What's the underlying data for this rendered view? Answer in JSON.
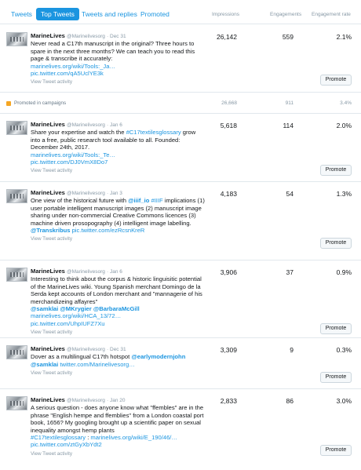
{
  "tabs": [
    "Tweets",
    "Top Tweets",
    "Tweets and replies",
    "Promoted"
  ],
  "columns": {
    "impressions": "Impressions",
    "engagements": "Engagements",
    "rate": "Engagement rate"
  },
  "view_activity": "View Tweet activity",
  "promote_label": "Promote",
  "promoted": {
    "label": "Promoted in campaigns",
    "impressions": "26,668",
    "engagements": "911",
    "rate": "3.4%"
  },
  "tweets": [
    {
      "name": "MarineLives",
      "handle": "@Marinelivesorg",
      "date": "· Dec 31",
      "text": "Never read a C17th manuscript in the original? Three hours to spare in the next three months? We can teach you to read this page & transcribe it accurately:",
      "link1": "marinelives.org/wiki/Tools:_Ja…",
      "link2": "pic.twitter.com/qA5UclYE3k",
      "impressions": "26,142",
      "engagements": "559",
      "rate": "2.1%"
    },
    {
      "name": "MarineLives",
      "handle": "@Marinelivesorg",
      "date": "· Jan 6",
      "text_a": "Share your expertise and watch the ",
      "hashtag": "#C17textilesglossary",
      "text_b": " grow into a free, public research tool available to all. Founded: December 24th, 2017.",
      "link1": "marinelives.org/wiki/Tools:_Te…",
      "link2": "pic.twitter.com/DJ0VmX8Do7",
      "impressions": "5,618",
      "engagements": "114",
      "rate": "2.0%"
    },
    {
      "name": "MarineLives",
      "handle": "@Marinelivesorg",
      "date": "· Jan 3",
      "text_a": "One view of the historical future with ",
      "mention1": "@iiif_io",
      "hashtag": "#IIIF",
      "text_b": " implications (1) user portable intelligent manuscript images (2) manuscript image sharing under non-commercial Creative Commons licences (3) machine driven prosopography (4) intelligent image labelling.",
      "mention2": "@Transkribus",
      "link2": "pic.twitter.com/ezRcsnKreR",
      "impressions": "4,183",
      "engagements": "54",
      "rate": "1.3%"
    },
    {
      "name": "MarineLives",
      "handle": "@Marinelivesorg",
      "date": "· Jan 6",
      "text": "Interesting to think about the corpus & historic linguisitic potential of the MarineLives wiki. Young Spanish merchant Domingo de la Serda kept accounts of London merchant and \"mannagerie of his merchandizeing affayres\"",
      "mention1": "@samklai",
      "mention2": "@MKrygier",
      "mention3": "@BarbaraMcGill",
      "link1": "marinelives.org/wiki/HCA_13/72…",
      "link2": "pic.twitter.com/UhpIUFZ7Xu",
      "impressions": "3,906",
      "engagements": "37",
      "rate": "0.9%"
    },
    {
      "name": "MarineLives",
      "handle": "@Marinelivesorg",
      "date": "· Dec 31",
      "text_a": "Dover as a multilingual C17th hotspot ",
      "mention1": "@earlymodernjohn",
      "mention2": "@samklai",
      "link1": "twitter.com/Marinelivesorg…",
      "impressions": "3,309",
      "engagements": "9",
      "rate": "0.3%"
    },
    {
      "name": "MarineLives",
      "handle": "@Marinelivesorg",
      "date": "· Jan 20",
      "text": "A serious question - does anyone know what \"ffembles\" are in the phrase \"English hempe and ffemblies\" from a London coastal port book, 1656? My googling brought up a scientific paper on sexual inequality amongst hemp plants",
      "hashtag": "#C17textilesglossary",
      "link1": "marinelives.org/wiki/E_190/46/…",
      "link2": "pic.twitter.com/ztGyXbYdt2",
      "impressions": "2,833",
      "engagements": "86",
      "rate": "3.0%"
    }
  ]
}
